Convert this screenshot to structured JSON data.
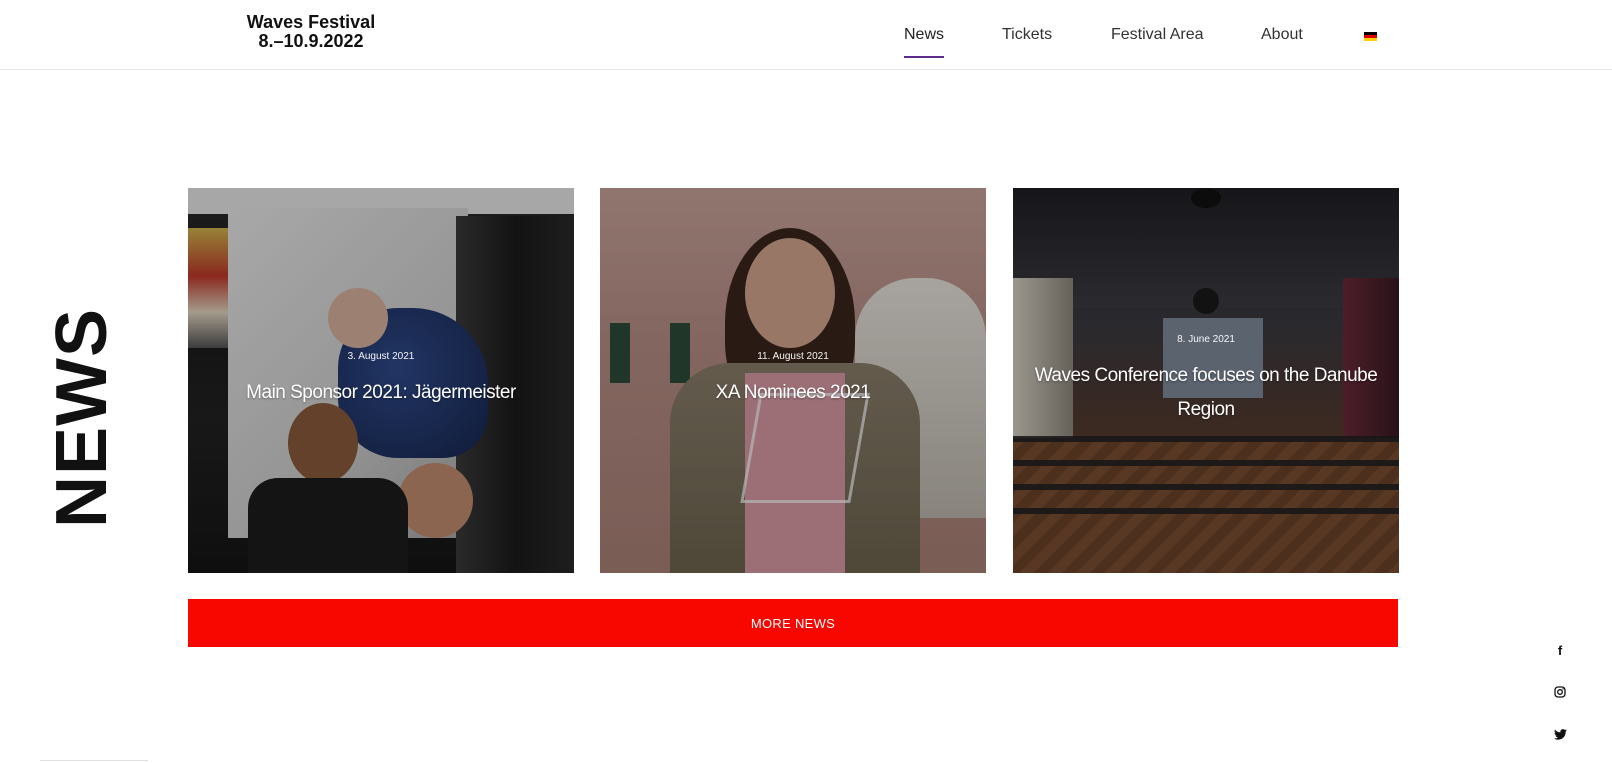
{
  "header": {
    "logo_line1": "Waves Festival",
    "logo_line2": "8.–10.9.2022"
  },
  "nav": {
    "items": [
      {
        "label": "News",
        "active": true
      },
      {
        "label": "Tickets",
        "active": false
      },
      {
        "label": "Festival Area",
        "active": false
      },
      {
        "label": "About",
        "active": false
      }
    ],
    "language_icon": "german-flag-icon",
    "active_underline_color": "#5b2a8a"
  },
  "section": {
    "title": "NEWS"
  },
  "cards": [
    {
      "date": "3. August 2021",
      "title": "Main Sponsor 2021: Jägermeister"
    },
    {
      "date": "11. August 2021",
      "title": "XA Nominees 2021"
    },
    {
      "date": "8. June 2021",
      "title": "Waves Conference focuses on the Danube Region"
    }
  ],
  "more_news": {
    "label": "MORE NEWS",
    "color": "#f80700"
  },
  "social": {
    "icons": [
      "facebook-icon",
      "instagram-icon",
      "twitter-icon"
    ]
  }
}
